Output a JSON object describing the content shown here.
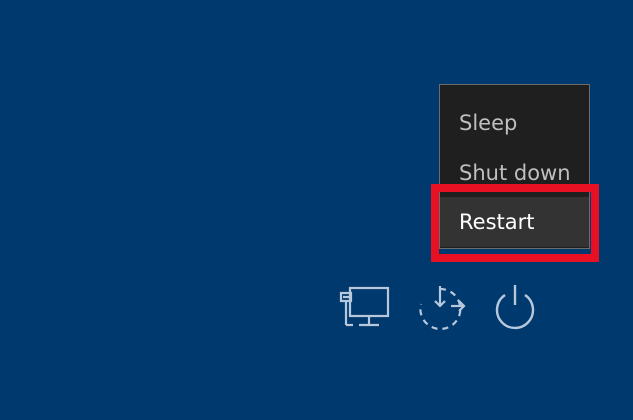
{
  "power_menu": {
    "items": [
      {
        "label": "Sleep"
      },
      {
        "label": "Shut down"
      },
      {
        "label": "Restart"
      }
    ],
    "highlighted_item": "Restart"
  },
  "tray": {
    "icons": [
      "network-icon",
      "ease-of-access-icon",
      "power-icon"
    ]
  },
  "colors": {
    "background": "#00396d",
    "menu_background": "#1f1f1f",
    "menu_selected": "#333333",
    "highlight_border": "#e81123",
    "icon": "#b8c8dc"
  }
}
